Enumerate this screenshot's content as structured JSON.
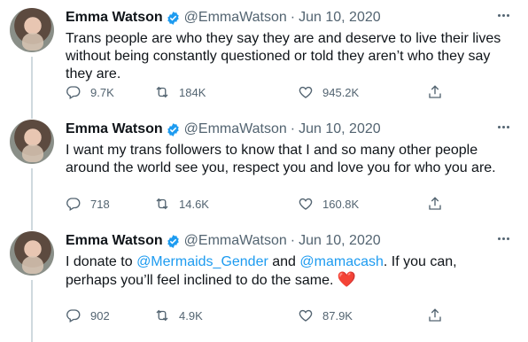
{
  "tweets": [
    {
      "name": "Emma Watson",
      "handle": "@EmmaWatson",
      "separator": "·",
      "date": "Jun 10, 2020",
      "text_parts": [
        "Trans people are who they say they are and deserve to live their lives without being constantly questioned or told they aren’t who they say they are."
      ],
      "replies": "9.7K",
      "retweets": "184K",
      "likes": "945.2K"
    },
    {
      "name": "Emma Watson",
      "handle": "@EmmaWatson",
      "separator": "·",
      "date": "Jun 10, 2020",
      "text_parts": [
        "I want my trans followers to know that I and so many other people around the world see you, respect you and love you for who you are."
      ],
      "replies": "718",
      "retweets": "14.6K",
      "likes": "160.8K"
    },
    {
      "name": "Emma Watson",
      "handle": "@EmmaWatson",
      "separator": "·",
      "date": "Jun 10, 2020",
      "text_parts": [
        "I donate to ",
        "@Mermaids_Gender",
        " and ",
        "@mamacash",
        ". If you can, perhaps you’ll feel inclined to do the same. "
      ],
      "emoji": "❤️",
      "replies": "902",
      "retweets": "4.9K",
      "likes": "87.9K"
    }
  ],
  "colors": {
    "accent": "#1d9bf0",
    "secondary_text": "#536471",
    "primary_text": "#0f1419",
    "thread_line": "#cfd9de",
    "heart": "#e0245e"
  },
  "icons": [
    "verified-badge-icon",
    "more-icon",
    "reply-icon",
    "retweet-icon",
    "like-icon",
    "share-icon"
  ]
}
